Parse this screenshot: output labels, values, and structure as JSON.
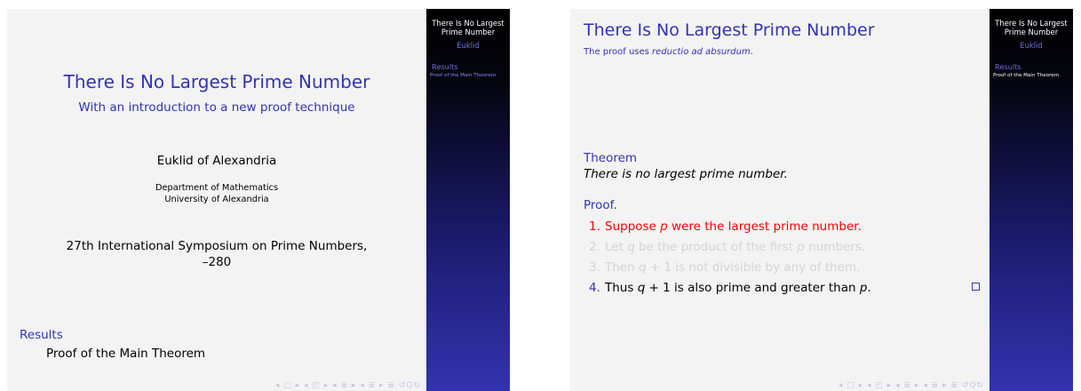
{
  "slide1": {
    "title": "There Is No Largest Prime Number",
    "subtitle": "With an introduction to a new proof technique",
    "author": "Euklid of Alexandria",
    "institute_line1": "Department of Mathematics",
    "institute_line2": "University of Alexandria",
    "date_line1": "27th International Symposium on Prime Numbers,",
    "date_line2": "–280",
    "toc": {
      "section": "Results",
      "subsection": "Proof of the Main Theorem"
    }
  },
  "slide2": {
    "frame_title": "There Is No Largest Prime Number",
    "frame_subtitle_prefix": "The proof uses ",
    "frame_subtitle_emph": "reductio ad absurdum",
    "frame_subtitle_suffix": ".",
    "theorem_title": "Theorem",
    "theorem_body": "There is no largest prime number.",
    "proof_title": "Proof.",
    "steps": [
      {
        "num": "1.",
        "a": "Suppose ",
        "v": "p",
        "b": " were the largest prime number."
      },
      {
        "num": "2.",
        "a": "Let ",
        "v": "q",
        "b": " be the product of the first ",
        "v2": "p",
        "c": " numbers."
      },
      {
        "num": "3.",
        "a": "Then ",
        "v": "q",
        "b": " + 1 is not divisible by any of them."
      },
      {
        "num": "4.",
        "a": "Thus ",
        "v": "q",
        "b": " + 1 is also prime and greater than ",
        "v2": "p",
        "c": "."
      }
    ]
  },
  "sidebar": {
    "title": "There Is No Largest Prime Number",
    "author": "Euklid",
    "section": "Results",
    "subsection": "Proof of the Main Theorem"
  },
  "nav": {
    "symbols": "◂ □ ▸ ◂ ◰ ▸ ◂ ≣ ▸ ◂ ≣ ▸ ≣ ↺Q↻"
  },
  "colors": {
    "structure": "#3333b3",
    "alert": "#ff0000",
    "slide_bg": "#f3f3f3"
  }
}
